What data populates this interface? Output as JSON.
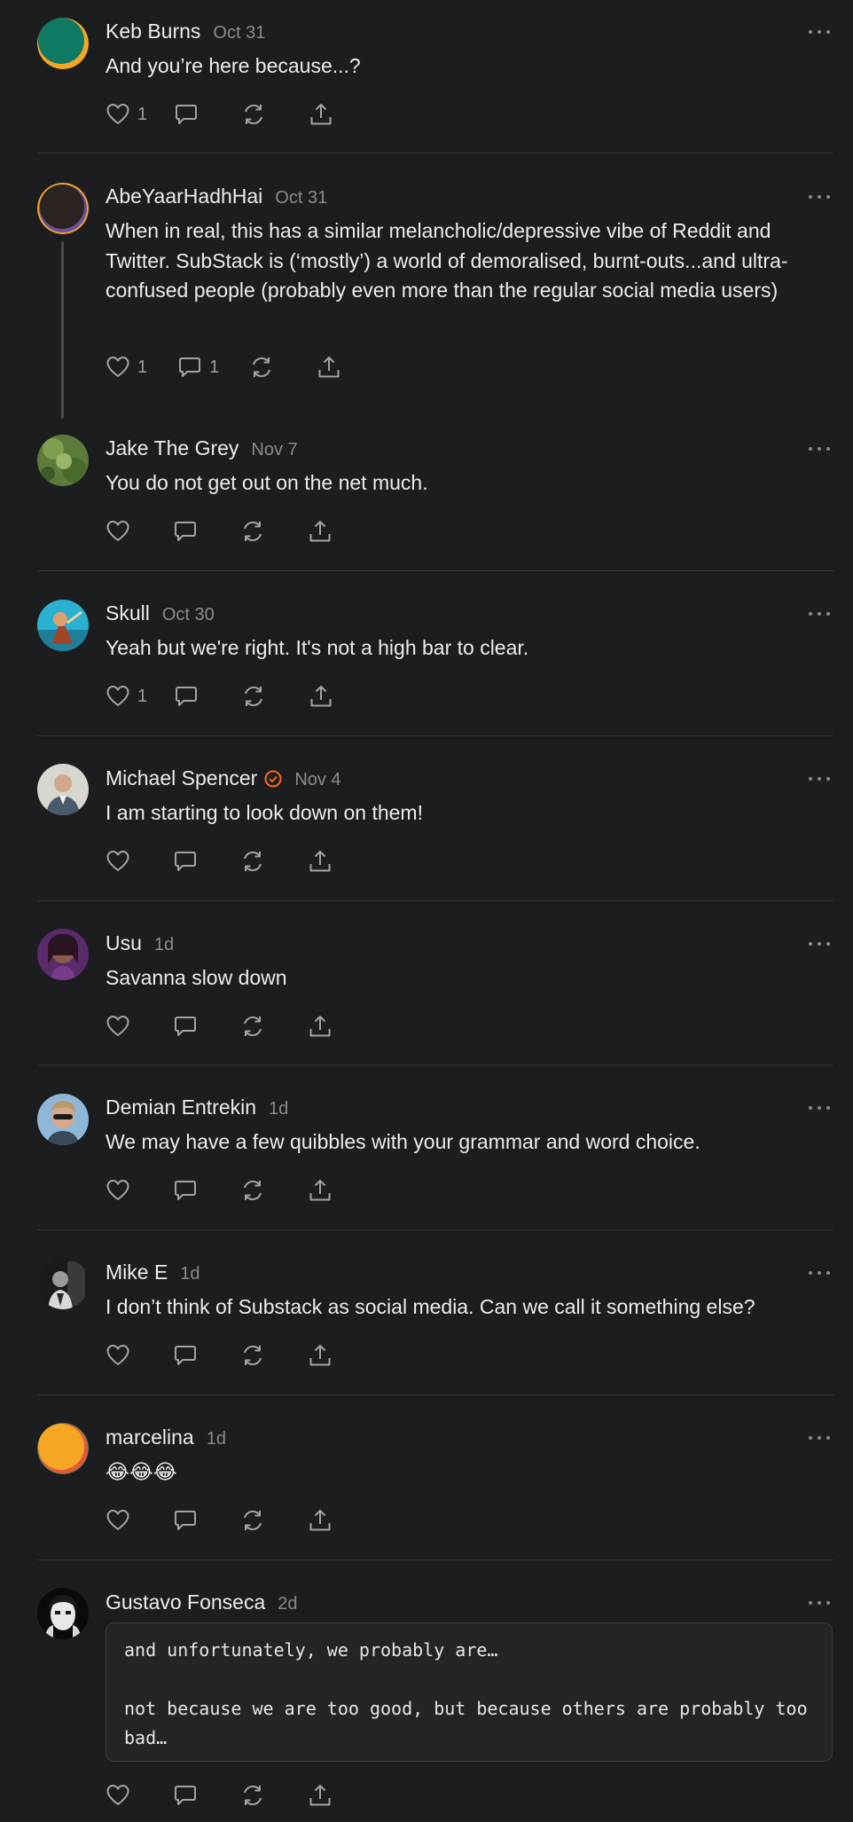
{
  "comments": [
    {
      "author": "Keb Burns",
      "date": "Oct 31",
      "text": "And you’re here because...?",
      "likes": "1",
      "replies": ""
    },
    {
      "author": "AbeYaarHadhHai",
      "date": "Oct 31",
      "text": "When in real, this has a similar melancholic/depressive vibe of Reddit and Twitter. SubStack is (‘mostly’) a world of demoralised, burnt-outs...and ultra-confused people (probably even more than the regular social media users)",
      "likes": "1",
      "replies": "1"
    },
    {
      "author": "Jake The Grey",
      "date": "Nov 7",
      "text": "You do not get out on the net much.",
      "likes": "",
      "replies": ""
    },
    {
      "author": "Skull",
      "date": "Oct 30",
      "text": "Yeah but we're right. It's not a high bar to clear.",
      "likes": "1",
      "replies": ""
    },
    {
      "author": "Michael Spencer",
      "date": "Nov 4",
      "text": "I am starting to look down on them!",
      "likes": "",
      "replies": ""
    },
    {
      "author": "Usu",
      "date": "1d",
      "text": "Savanna slow down",
      "likes": "",
      "replies": ""
    },
    {
      "author": "Demian Entrekin",
      "date": "1d",
      "text": "We may have a few quibbles with your grammar and word choice.",
      "likes": "",
      "replies": ""
    },
    {
      "author": "Mike E",
      "date": "1d",
      "text": "I don’t think of Substack as social media. Can we call it something else?",
      "likes": "",
      "replies": ""
    },
    {
      "author": "marcelina",
      "date": "1d",
      "text": "😂😂😂",
      "likes": "",
      "replies": ""
    },
    {
      "author": "Gustavo Fonseca",
      "date": "2d",
      "code": "and unfortunately, we probably are…\n\nnot because we are too good, but because others are probably too bad…",
      "likes": "",
      "replies": ""
    }
  ],
  "icons": {
    "like": "heart-icon",
    "reply": "comment-bubble-icon",
    "restack": "restack-icon",
    "share": "share-icon",
    "more": "more-options-icon",
    "verified": "verified-badge-icon"
  },
  "colors": {
    "background": "#1c1d1f",
    "text": "#ececec",
    "muted": "#8a8b8e",
    "verified": "#ff6719"
  }
}
